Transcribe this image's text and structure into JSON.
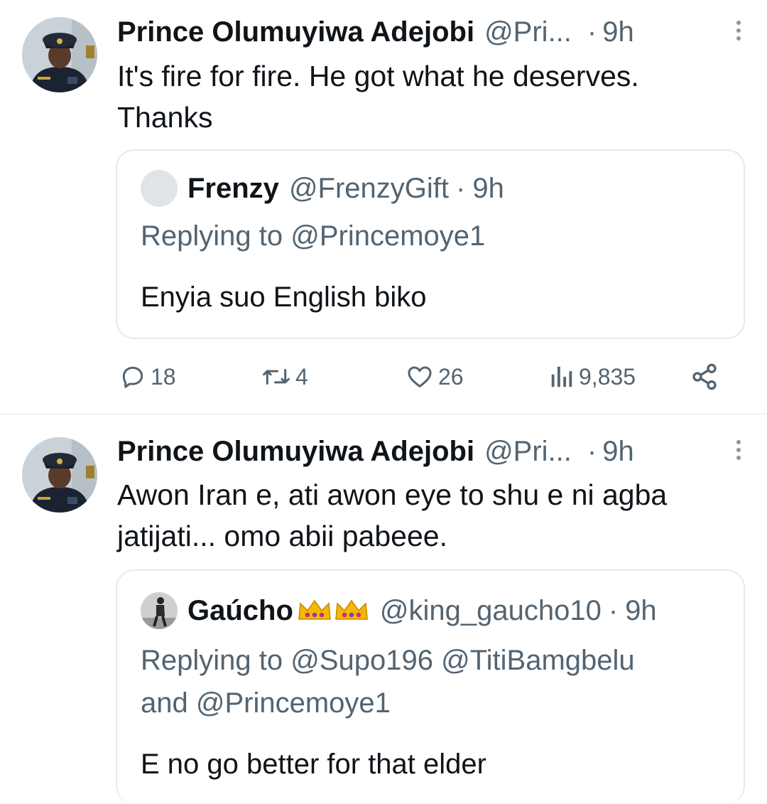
{
  "tweets": [
    {
      "author": "Prince Olumuyiwa Adejobi",
      "handle": "@Pri...",
      "dot": "·",
      "time": "9h",
      "text_lines": [
        "It's fire for fire. He got what he deserves.",
        "Thanks"
      ],
      "quote": {
        "name": "Frenzy",
        "handle": "@FrenzyGift",
        "sep": "·",
        "time": "9h",
        "replying_lines": [
          "Replying to @Princemoye1"
        ],
        "text": "Enyia suo English biko"
      },
      "actions": {
        "replies": "18",
        "reposts": "4",
        "likes": "26",
        "views": "9,835"
      }
    },
    {
      "author": "Prince Olumuyiwa Adejobi",
      "handle": "@Pri...",
      "dot": "·",
      "time": "9h",
      "text_lines": [
        "Awon Iran e, ati awon eye to shu e ni agba",
        "jatijati... omo abii pabeee."
      ],
      "quote": {
        "name": "Gaúcho",
        "crowns": "👑👑",
        "handle": "@king_gaucho10",
        "sep": "·",
        "time": "9h",
        "replying_lines": [
          "Replying to @Supo196 @TitiBamgbelu",
          "and @Princemoye1"
        ],
        "text": "E no go better for that elder"
      }
    }
  ],
  "icons": {
    "reply": "reply-icon",
    "repost": "repost-icon",
    "like": "heart-icon",
    "views": "views-icon",
    "share": "share-icon",
    "more": "more-vertical-icon"
  },
  "colors": {
    "text": "#0f1419",
    "secondary": "#536471",
    "border": "#e6e9ec",
    "crown": "#f5b800"
  }
}
